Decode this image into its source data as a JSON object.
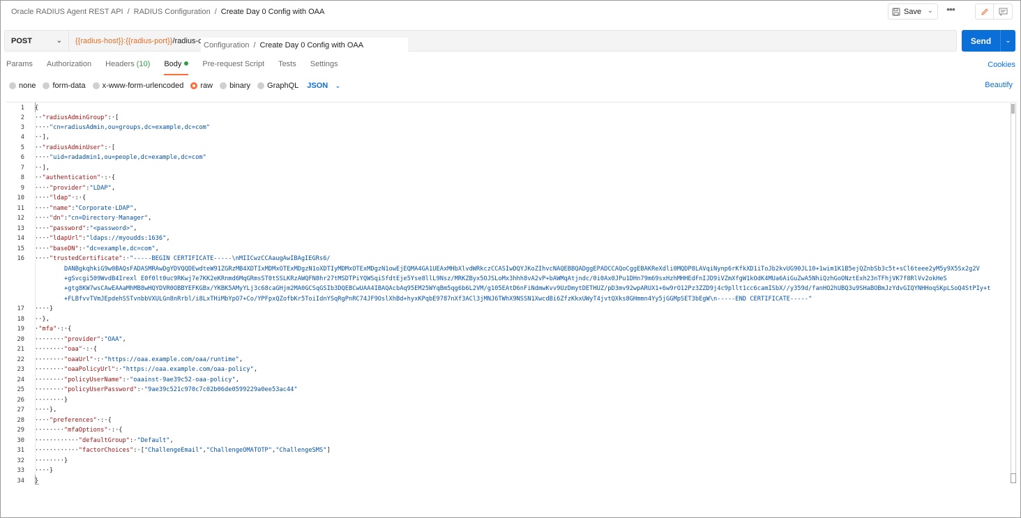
{
  "breadcrumb": {
    "collection": "Oracle RADIUS Agent REST API",
    "folder": "RADIUS Configuration",
    "sep": "/",
    "request": "Create Day 0 Config with OAA"
  },
  "header": {
    "save_label": "Save",
    "more_label": "•••"
  },
  "request": {
    "method": "POST",
    "url_var1": "{{radius-host}}",
    "url_colon": ":",
    "url_var2": "{{radius-port}}",
    "url_rest": "/radius-co",
    "tooltip_path": "Configuration",
    "tooltip_sep": "/",
    "tooltip_current": "Create Day 0 Config with OAA",
    "send_label": "Send"
  },
  "tabs": [
    {
      "label": "Params"
    },
    {
      "label": "Authorization"
    },
    {
      "label": "Headers",
      "count": "(10)"
    },
    {
      "label": "Body"
    },
    {
      "label": "Pre-request Script"
    },
    {
      "label": "Tests"
    },
    {
      "label": "Settings"
    }
  ],
  "cookies_label": "Cookies",
  "body_options": [
    "none",
    "form-data",
    "x-www-form-urlencoded",
    "raw",
    "binary",
    "GraphQL"
  ],
  "body_language": "JSON",
  "beautify_label": "Beautify",
  "editor": {
    "line_numbers": [
      "1",
      "2",
      "3",
      "4",
      "5",
      "6",
      "7",
      "8",
      "9",
      "10",
      "11",
      "12",
      "13",
      "14",
      "15",
      "16",
      "17",
      "18",
      "19",
      "20",
      "21",
      "22",
      "23",
      "24",
      "25",
      "26",
      "27",
      "28",
      "29",
      "30",
      "31",
      "32",
      "33",
      "34"
    ],
    "cert_line1": "\"-----BEGIN CERTIFICATE-----\\nMIICwzCCAaugAwIBAgIEGRs6/",
    "cert_line2": "DANBgkqhkiG9w0BAQsFADASMRAwDgYDVQQDEwdteW91ZGRzMB4XDTIxMDMxOTExMDgzN1oXDTIyMDMxOTExMDgzN1owEjEQMA4GA1UEAxMHbXlvdWRkczCCASIwDQYJKoZIhvcNAQEBBQADggEPADCCAQoCggEBAKReXdli0MQDP8LAVqiNynp6rKfkXD1iToJb2kvUG90JL10+1wim1K1B5ejQZnbSb3c5t+sCl6teee2yM5y9X5Sx2g2V",
    "cert_line3": "+gSvcgi509WvdB4Irexl E0f0lt0uc9RKwj7e7KK2eKRnmd6MqGRmsST0tSSLKRzAWQFN8hr27tMSDTPiYQWSqiSfdtEje5Yse8llL9Nsz/MRKZByx5OJSLoMx3hhh8vA2vP+bAWMqAtjndc/0i0Ax0JPu1DHn79m69sxHzhMHHEdFnIJD9iVZmXfgW1kOdK4MUa6AiGuZwA5NhiQzhGoONztExh23nTFhjVK7f8RlVv2okHeS",
    "cert_line4": "+gtg8KW7wsCAwEAAaMhMB8wHQYDVR0OBBYEFKGBx/YKBK5AMyYLj3c68caGHjm2MA0GCSqGSIb3DQEBCwUAA4IBAQAcbAq95EM25WYqBm5qg6b6L2VM/g105EAtD6nFiNdmwKvv9UzDmytDETHUZ/pD3mv92wpARUX1+6w9rO12Pz3ZZD9j4c9pllt1cc6camISbX//y359d/fanHO2hUBQ3u9SHaBOBmJzYdvGIQYNHHoqSKpLSoQ4StPIy+t",
    "cert_line5": "+FLBfvvTVmJEpdehSSTvnbbVXULGn8nRrbl/i8LxTHiMbYpO7+Co/YPFpxQZofbKr5ToiIdnYSqRgPnRC74JF9OslXhBd+hyxKPqbE9787nXf3ACl3jMNJ6TWhX9NSSN1XwcdBi6ZfzKkxUWyT4jvtQXks8GHmmn4Yy5jGGMpSET3bEgW\\n-----END CERTIFICATE-----\""
  }
}
